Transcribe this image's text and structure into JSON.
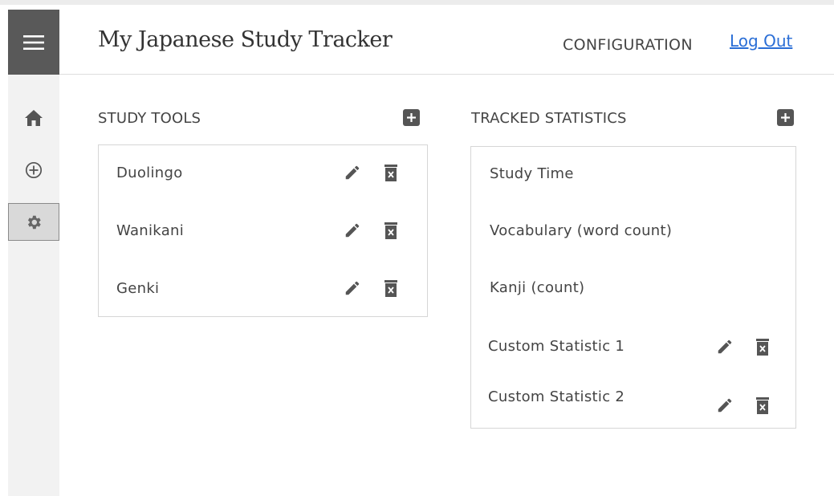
{
  "header": {
    "title": "My Japanese Study Tracker",
    "config_label": "CONFIGURATION",
    "logout_label": "Log Out"
  },
  "sidebar": {
    "menu_icon": "hamburger-icon",
    "items": [
      {
        "icon": "home-icon"
      },
      {
        "icon": "add-circle-icon"
      },
      {
        "icon": "gear-icon",
        "active": true
      }
    ]
  },
  "study_tools": {
    "title": "STUDY TOOLS",
    "items": [
      {
        "label": "Duolingo"
      },
      {
        "label": "Wanikani"
      },
      {
        "label": "Genki"
      }
    ]
  },
  "tracked_statistics": {
    "title": "TRACKED STATISTICS",
    "items": [
      {
        "label": "Study Time",
        "editable": false
      },
      {
        "label": "Vocabulary (word count)",
        "editable": false
      },
      {
        "label": "Kanji (count)",
        "editable": false
      },
      {
        "label": "Custom Statistic 1",
        "editable": true
      },
      {
        "label": "Custom Statistic 2",
        "editable": true
      }
    ]
  },
  "colors": {
    "menu_bg": "#595959",
    "link": "#2a6ed6",
    "icon": "#555555"
  }
}
